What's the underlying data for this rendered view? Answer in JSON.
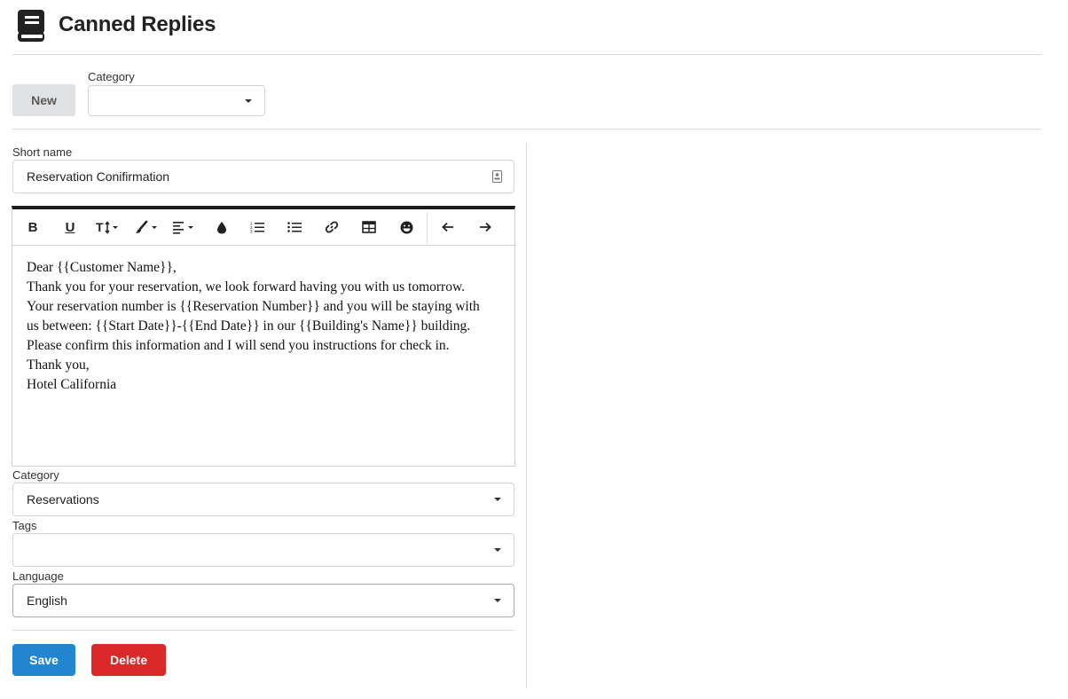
{
  "header": {
    "title": "Canned Replies",
    "icon": "book-icon"
  },
  "top_bar": {
    "new_label": "New",
    "category_label": "Category",
    "category_value": ""
  },
  "form": {
    "short_name_label": "Short name",
    "short_name_value": "Reservation Conifirmation",
    "editor_lines": [
      "Dear {{Customer Name}},",
      "Thank you for your reservation, we look forward having you with us tomorrow.",
      "Your reservation number is {{Reservation Number}} and you will be staying with",
      "us between: {{Start Date}}-{{End Date}} in our {{Building's Name}} building.",
      "Please confirm this information and I will send you instructions for check in.",
      "Thank you,",
      "Hotel California"
    ],
    "toolbar_buttons": [
      "bold-icon",
      "underline-icon",
      "font-size-icon",
      "brush-icon",
      "align-icon",
      "color-drop-icon",
      "ordered-list-icon",
      "unordered-list-icon",
      "link-icon",
      "table-icon",
      "emoji-icon",
      "undo-icon",
      "redo-icon"
    ],
    "category_label": "Category",
    "category_value": "Reservations",
    "tags_label": "Tags",
    "tags_value": "",
    "language_label": "Language",
    "language_value": "English",
    "save_label": "Save",
    "delete_label": "Delete"
  },
  "colors": {
    "primary": "#2185d0",
    "danger": "#db2828",
    "neutral": "#e0e1e2"
  }
}
